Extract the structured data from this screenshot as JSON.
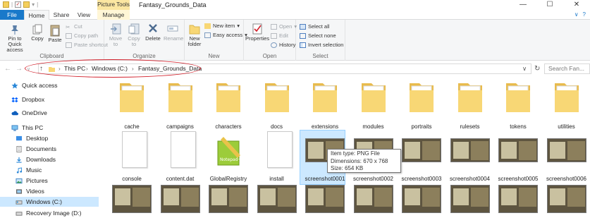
{
  "window": {
    "title": "Fantasy_Grounds_Data",
    "context_tab": "Picture Tools",
    "minimize": "—",
    "maximize": "☐",
    "close": "✕"
  },
  "tabs": {
    "file": "File",
    "home": "Home",
    "share": "Share",
    "view": "View",
    "manage": "Manage"
  },
  "ribbon": {
    "clipboard": {
      "label": "Clipboard",
      "pin": "Pin to Quick access",
      "copy": "Copy",
      "paste": "Paste",
      "cut": "Cut",
      "copy_path": "Copy path",
      "paste_shortcut": "Paste shortcut"
    },
    "organize": {
      "label": "Organize",
      "move_to": "Move to",
      "copy_to": "Copy to",
      "delete": "Delete",
      "rename": "Rename"
    },
    "new": {
      "label": "New",
      "new_folder": "New folder",
      "new_item": "New item",
      "easy_access": "Easy access"
    },
    "open": {
      "label": "Open",
      "properties": "Properties",
      "open": "Open",
      "edit": "Edit",
      "history": "History"
    },
    "select": {
      "label": "Select",
      "select_all": "Select all",
      "select_none": "Select none",
      "invert": "Invert selection"
    }
  },
  "address": {
    "crumbs": [
      "This PC",
      "Windows (C:)",
      "Fantasy_Grounds_Data"
    ],
    "search_placeholder": "Search Fan..."
  },
  "nav_pane": [
    {
      "label": "Quick access",
      "icon": "star-icon"
    },
    {
      "label": "Dropbox",
      "icon": "dropbox-icon"
    },
    {
      "label": "OneDrive",
      "icon": "cloud-icon"
    },
    {
      "label": "This PC",
      "icon": "computer-icon"
    },
    {
      "label": "Desktop",
      "icon": "desktop-folder-icon"
    },
    {
      "label": "Documents",
      "icon": "documents-folder-icon"
    },
    {
      "label": "Downloads",
      "icon": "downloads-folder-icon"
    },
    {
      "label": "Music",
      "icon": "music-folder-icon"
    },
    {
      "label": "Pictures",
      "icon": "pictures-folder-icon"
    },
    {
      "label": "Videos",
      "icon": "videos-folder-icon"
    },
    {
      "label": "Windows (C:)",
      "icon": "drive-icon"
    },
    {
      "label": "Recovery Image (D:)",
      "icon": "drive-icon"
    }
  ],
  "folders": [
    "cache",
    "campaigns",
    "characters",
    "docs",
    "extensions",
    "modules",
    "portraits",
    "rulesets",
    "tokens",
    "utilities"
  ],
  "files": [
    "console",
    "content.dat",
    "GlobalRegistry",
    "install",
    "screenshot0001",
    "screenshot0002",
    "screenshot0003",
    "screenshot0004",
    "screenshot0005",
    "screenshot0006"
  ],
  "tooltip": {
    "type": "Item type: PNG File",
    "dimensions": "Dimensions: 670 x 768",
    "size": "Size: 654 KB"
  },
  "colors": {
    "accent": "#1979ca",
    "folder": "#f8d775",
    "selection": "#cce8ff",
    "annotation": "#d21f2a"
  }
}
